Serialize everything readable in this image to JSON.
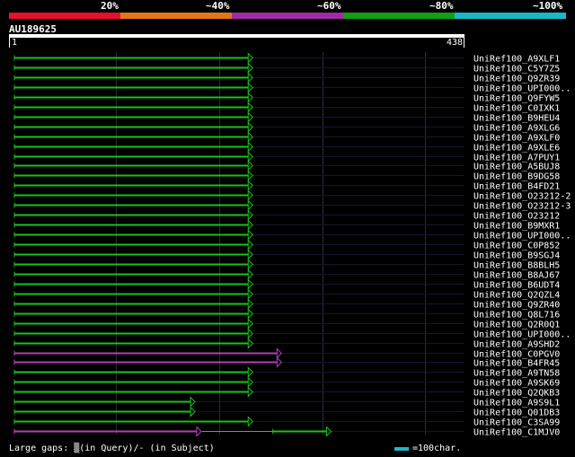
{
  "identity_legend": {
    "labels": [
      "20%",
      "~40%",
      "~60%",
      "~80%",
      "~100%"
    ],
    "colors": [
      "#e8102c",
      "#e57518",
      "#a02aa6",
      "#12a012",
      "#18b8c8"
    ]
  },
  "query": {
    "id": "AU189625",
    "start": "1",
    "end": "438",
    "length": 438
  },
  "colors": {
    "green": "#19c219",
    "magenta": "#b23fb5",
    "grid_line": "#15152e",
    "grid_dark": "#444"
  },
  "hits": [
    {
      "name": "UniRef100_A9XLF1",
      "segments": [
        [
          1,
          228
        ]
      ],
      "color": "green"
    },
    {
      "name": "UniRef100_C5Y7Z5",
      "segments": [
        [
          1,
          228
        ]
      ],
      "color": "green"
    },
    {
      "name": "UniRef100_Q9ZR39",
      "segments": [
        [
          1,
          228
        ]
      ],
      "color": "green"
    },
    {
      "name": "UniRef100_UPI000..",
      "segments": [
        [
          1,
          228
        ]
      ],
      "color": "green"
    },
    {
      "name": "UniRef100_Q9FYW5",
      "segments": [
        [
          1,
          228
        ]
      ],
      "color": "green"
    },
    {
      "name": "UniRef100_C0IXK1",
      "segments": [
        [
          1,
          228
        ]
      ],
      "color": "green"
    },
    {
      "name": "UniRef100_B9HEU4",
      "segments": [
        [
          1,
          228
        ]
      ],
      "color": "green"
    },
    {
      "name": "UniRef100_A9XLG6",
      "segments": [
        [
          1,
          228
        ]
      ],
      "color": "green"
    },
    {
      "name": "UniRef100_A9XLF0",
      "segments": [
        [
          1,
          228
        ]
      ],
      "color": "green"
    },
    {
      "name": "UniRef100_A9XLE6",
      "segments": [
        [
          1,
          228
        ]
      ],
      "color": "green"
    },
    {
      "name": "UniRef100_A7PUY1",
      "segments": [
        [
          1,
          228
        ]
      ],
      "color": "green"
    },
    {
      "name": "UniRef100_A5BUJ8",
      "segments": [
        [
          1,
          228
        ]
      ],
      "color": "green"
    },
    {
      "name": "UniRef100_B9DG58",
      "segments": [
        [
          1,
          228
        ]
      ],
      "color": "green"
    },
    {
      "name": "UniRef100_B4FD21",
      "segments": [
        [
          1,
          228
        ]
      ],
      "color": "green"
    },
    {
      "name": "UniRef100_O23212-2",
      "segments": [
        [
          1,
          228
        ]
      ],
      "color": "green"
    },
    {
      "name": "UniRef100_O23212-3",
      "segments": [
        [
          1,
          228
        ]
      ],
      "color": "green"
    },
    {
      "name": "UniRef100_O23212",
      "segments": [
        [
          1,
          228
        ]
      ],
      "color": "green"
    },
    {
      "name": "UniRef100_B9MXR1",
      "segments": [
        [
          1,
          228
        ]
      ],
      "color": "green"
    },
    {
      "name": "UniRef100_UPI000..",
      "segments": [
        [
          1,
          228
        ]
      ],
      "color": "green"
    },
    {
      "name": "UniRef100_C0P852",
      "segments": [
        [
          1,
          228
        ]
      ],
      "color": "green"
    },
    {
      "name": "UniRef100_B9SGJ4",
      "segments": [
        [
          1,
          228
        ]
      ],
      "color": "green"
    },
    {
      "name": "UniRef100_B8BLH5",
      "segments": [
        [
          1,
          228
        ]
      ],
      "color": "green"
    },
    {
      "name": "UniRef100_B8AJ67",
      "segments": [
        [
          1,
          228
        ]
      ],
      "color": "green"
    },
    {
      "name": "UniRef100_B6UDT4",
      "segments": [
        [
          1,
          228
        ]
      ],
      "color": "green"
    },
    {
      "name": "UniRef100_Q2QZL4",
      "segments": [
        [
          1,
          228
        ]
      ],
      "color": "green"
    },
    {
      "name": "UniRef100_Q9ZR40",
      "segments": [
        [
          1,
          228
        ]
      ],
      "color": "green"
    },
    {
      "name": "UniRef100_Q8L716",
      "segments": [
        [
          1,
          228
        ]
      ],
      "color": "green"
    },
    {
      "name": "UniRef100_Q2R0Q1",
      "segments": [
        [
          1,
          228
        ]
      ],
      "color": "green"
    },
    {
      "name": "UniRef100_UPI000..",
      "segments": [
        [
          1,
          228
        ]
      ],
      "color": "green"
    },
    {
      "name": "UniRef100_A9SHD2",
      "segments": [
        [
          1,
          228
        ]
      ],
      "color": "green"
    },
    {
      "name": "UniRef100_C0PGV0",
      "segments": [
        [
          1,
          256
        ]
      ],
      "color": "magenta"
    },
    {
      "name": "UniRef100_B4FR45",
      "segments": [
        [
          1,
          256
        ]
      ],
      "color": "magenta"
    },
    {
      "name": "UniRef100_A9TN58",
      "segments": [
        [
          1,
          228
        ]
      ],
      "color": "green"
    },
    {
      "name": "UniRef100_A9SK69",
      "segments": [
        [
          1,
          228
        ]
      ],
      "color": "green"
    },
    {
      "name": "UniRef100_Q2QKB3",
      "segments": [
        [
          1,
          228
        ]
      ],
      "color": "green"
    },
    {
      "name": "UniRef100_A9S9L1",
      "segments": [
        [
          1,
          172
        ]
      ],
      "color": "green"
    },
    {
      "name": "UniRef100_Q01DB3",
      "segments": [
        [
          1,
          172
        ]
      ],
      "color": "green"
    },
    {
      "name": "UniRef100_C3SA99",
      "segments": [
        [
          1,
          228
        ]
      ],
      "color": "green"
    },
    {
      "name": "UniRef100_C1MJV0",
      "segments": [
        [
          1,
          178
        ],
        [
          252,
          304
        ]
      ],
      "color": "mixed"
    }
  ],
  "footer": {
    "gaps_text": "Large gaps: ▒(in Query)/- (in Subject)",
    "scale_text": "=100char."
  }
}
